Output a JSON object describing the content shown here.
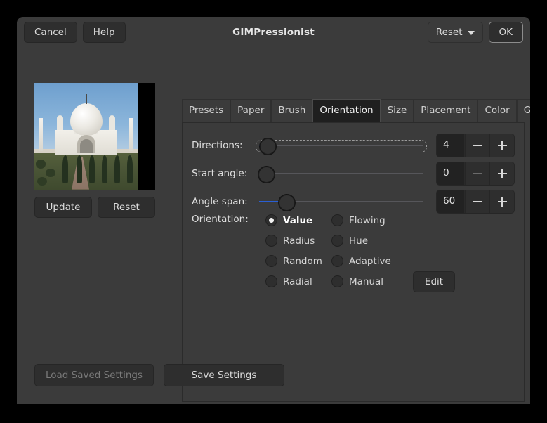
{
  "window": {
    "title": "GIMPressionist"
  },
  "header": {
    "cancel_label": "Cancel",
    "help_label": "Help",
    "reset_label": "Reset",
    "ok_label": "OK",
    "reset_icon": "chevron-down-icon"
  },
  "preview": {
    "image_alt": "Taj Mahal preview",
    "update_label": "Update",
    "reset_label": "Reset"
  },
  "notebook": {
    "tabs": [
      {
        "label": "Presets",
        "active": false
      },
      {
        "label": "Paper",
        "active": false
      },
      {
        "label": "Brush",
        "active": false
      },
      {
        "label": "Orientation",
        "active": true
      },
      {
        "label": "Size",
        "active": false
      },
      {
        "label": "Placement",
        "active": false
      },
      {
        "label": "Color",
        "active": false
      },
      {
        "label": "General",
        "active": false
      }
    ]
  },
  "orientation_page": {
    "sliders": [
      {
        "label": "Directions:",
        "value": "4",
        "fraction": 0.055,
        "focused": true,
        "minus_enabled": true,
        "plus_enabled": true
      },
      {
        "label": "Start angle:",
        "value": "0",
        "fraction": 0.0,
        "focused": false,
        "minus_enabled": false,
        "plus_enabled": true
      },
      {
        "label": "Angle span:",
        "value": "60",
        "fraction": 0.165,
        "focused": false,
        "minus_enabled": true,
        "plus_enabled": true
      }
    ],
    "orientation_label": "Orientation:",
    "radios": [
      {
        "label": "Value",
        "selected": true,
        "column": 1
      },
      {
        "label": "Flowing",
        "selected": false,
        "column": 2
      },
      {
        "label": "Radius",
        "selected": false,
        "column": 1
      },
      {
        "label": "Hue",
        "selected": false,
        "column": 2
      },
      {
        "label": "Random",
        "selected": false,
        "column": 1
      },
      {
        "label": "Adaptive",
        "selected": false,
        "column": 2
      },
      {
        "label": "Radial",
        "selected": false,
        "column": 1
      },
      {
        "label": "Manual",
        "selected": false,
        "column": 2
      }
    ],
    "edit_label": "Edit"
  },
  "footer": {
    "load_label": "Load Saved Settings",
    "load_enabled": false,
    "save_label": "Save Settings",
    "save_enabled": true
  },
  "colors": {
    "window_bg": "#3b3b3b",
    "button_bg": "#2e2e2e",
    "active_tab_bg": "#1f1f1f",
    "slider_fill": "#2a5fd4",
    "text": "#dedede",
    "desktop_bg": "#000000"
  }
}
